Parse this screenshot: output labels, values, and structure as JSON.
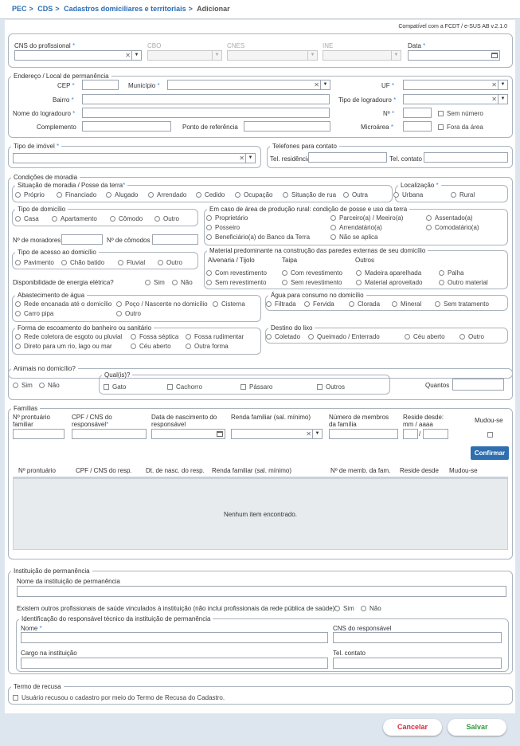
{
  "breadcrumb": {
    "pec": "PEC",
    "cds": "CDS",
    "cad": "Cadastros domiciliares e territoriais",
    "cur": "Adicionar",
    "sep": ">"
  },
  "compat": "Compatível com a FCDT / e-SUS AB v.2.1.0",
  "prof": {
    "cns": "CNS do profissional",
    "cbo": "CBO",
    "cnes": "CNES",
    "ine": "INE",
    "data": "Data"
  },
  "end": {
    "legend": "Endereço / Local de permanência",
    "cep": "CEP",
    "mun": "Município",
    "uf": "UF",
    "bairro": "Bairro",
    "tipo_log": "Tipo de logradouro",
    "nome_log": "Nome do logradouro",
    "num": "Nº",
    "sem_num": "Sem número",
    "compl": "Complemento",
    "ponto": "Ponto de referência",
    "micro": "Microárea",
    "fora": "Fora da área"
  },
  "imovel": {
    "legend": "Tipo de imóvel"
  },
  "tel": {
    "legend": "Telefones para contato",
    "res": "Tel. residência",
    "cont": "Tel. contato"
  },
  "cond": {
    "legend": "Condições de moradia",
    "sit": {
      "legend": "Situação de moradia / Posse da terra",
      "opts": [
        "Próprio",
        "Financiado",
        "Alugado",
        "Arrendado",
        "Cedido",
        "Ocupação",
        "Situação de rua",
        "Outra"
      ]
    },
    "loc": {
      "legend": "Localização",
      "opts": [
        "Urbana",
        "Rural"
      ]
    },
    "tdom": {
      "legend": "Tipo de domicílio",
      "opts": [
        "Casa",
        "Apartamento",
        "Cômodo",
        "Outro"
      ]
    },
    "rural": {
      "legend": "Em caso de área de produção rural: condição de posse e uso da terra",
      "opts": [
        "Proprietário",
        "Parceiro(a) / Meeiro(a)",
        "Assentado(a)",
        "Posseiro",
        "Arrendatário(a)",
        "Comodatário(a)",
        "Beneficiário(a) do Banco da Terra",
        "Não se aplica"
      ]
    },
    "nmor": "Nº de moradores",
    "ncom": "Nº de cômodos",
    "acesso": {
      "legend": "Tipo de acesso ao domicílio",
      "opts": [
        "Pavimento",
        "Chão batido",
        "Fluvial",
        "Outro"
      ]
    },
    "energia": {
      "label": "Disponibilidade de energia elétrica?",
      "opts": [
        "Sim",
        "Não"
      ]
    },
    "mat": {
      "legend": "Material predominante na construção das paredes externas de seu domicílio",
      "cols": [
        "Alvenaria / Tijolo",
        "Taipa",
        "Outros"
      ],
      "opts": [
        "Com revestimento",
        "Com revestimento",
        "Madeira aparelhada",
        "Palha",
        "Sem revestimento",
        "Sem revestimento",
        "Material aproveitado",
        "Outro material"
      ]
    },
    "agua": {
      "legend": "Abastecimento de água",
      "opts": [
        "Rede encanada até o domicílio",
        "Poço / Nascente no domicílio",
        "Cisterna",
        "Carro pipa",
        "Outro"
      ]
    },
    "consumo": {
      "legend": "Água para consumo no domicílio",
      "opts": [
        "Filtrada",
        "Fervida",
        "Clorada",
        "Mineral",
        "Sem tratamento"
      ]
    },
    "esc": {
      "legend": "Forma de escoamento do banheiro ou sanitário",
      "opts": [
        "Rede coletora de esgoto ou pluvial",
        "Fossa séptica",
        "Fossa rudimentar",
        "Direto para um rio, lago ou mar",
        "Céu aberto",
        "Outra forma"
      ]
    },
    "lixo": {
      "legend": "Destino do lixo",
      "opts": [
        "Coletado",
        "Queimado / Enterrado",
        "Céu aberto",
        "Outro"
      ]
    }
  },
  "animais": {
    "legend": "Animais no domicílio?",
    "opts": [
      "Sim",
      "Não"
    ],
    "quais": "Qual(is)?",
    "tipos": [
      "Gato",
      "Cachorro",
      "Pássaro",
      "Outros"
    ],
    "quantos": "Quantos"
  },
  "fam": {
    "legend": "Famílias",
    "pront": "Nº prontuário familiar",
    "cns": "CPF / CNS do responsável",
    "nasc": "Data de nascimento do responsável",
    "renda": "Renda familiar (sal. mínimo)",
    "membros": "Número de membros da família",
    "reside": "Reside desde: mm / aaaa",
    "mudou": "Mudou-se",
    "confirmar": "Confirmar",
    "cols": [
      "Nº prontuário",
      "CPF / CNS do resp.",
      "Dt. de nasc. do resp.",
      "Renda familiar (sal. mínimo)",
      "Nº de memb. da fam.",
      "Reside desde",
      "Mudou-se"
    ],
    "empty": "Nenhum item encontrado.",
    "slash": "/"
  },
  "inst": {
    "legend": "Instituição de permanência",
    "nome": "Nome da instituição de permanência",
    "outros": "Existem outros profissionais de saúde vinculados à instituição (não inclui profissionais da rede pública de saúde)?",
    "opts": [
      "Sim",
      "Não"
    ],
    "resp": {
      "legend": "Identificação do responsável técnico da instituição de permanência",
      "nome": "Nome",
      "cns": "CNS do responsável",
      "cargo": "Cargo na instituição",
      "tel": "Tel. contato"
    }
  },
  "recusa": {
    "legend": "Termo de recusa",
    "label": "Usuário recusou o cadastro por meio do Termo de Recusa do Cadastro."
  },
  "buttons": {
    "cancelar": "Cancelar",
    "salvar": "Salvar"
  },
  "colors": {
    "accent": "#2f6fb0",
    "cancel": "#d9283b",
    "save": "#2e9a3a",
    "star": "#3b8ee4"
  }
}
